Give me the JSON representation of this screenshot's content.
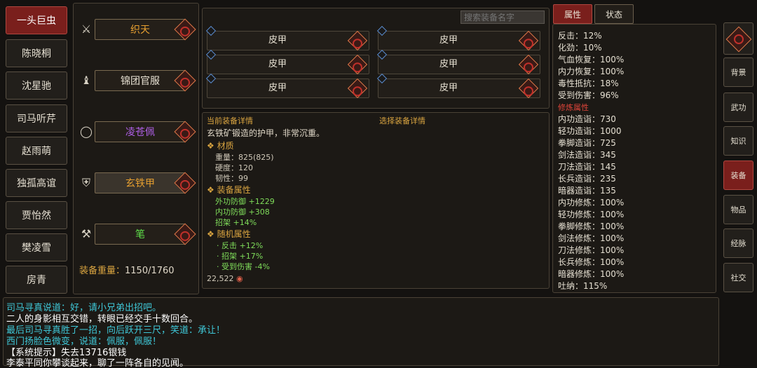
{
  "characters": [
    "一头巨虫",
    "陈晓桐",
    "沈星驰",
    "司马听芹",
    "赵雨萌",
    "独孤高谊",
    "贾怡然",
    "樊凌雪",
    "房青"
  ],
  "equip_slots": [
    {
      "icon": "sword-icon",
      "glyph": "⚔",
      "name": "织天",
      "color": "#e8a030"
    },
    {
      "icon": "robe-icon",
      "glyph": "♝",
      "name": "锦团官服",
      "color": "#e8e2d4"
    },
    {
      "icon": "ring-icon",
      "glyph": "◯",
      "name": "凌苍佩",
      "color": "#b060e8"
    },
    {
      "icon": "armor-icon",
      "glyph": "⛨",
      "name": "玄铁甲",
      "color": "#e8a030"
    },
    {
      "icon": "tool-icon",
      "glyph": "⚒",
      "name": "笔",
      "color": "#5fe04a"
    }
  ],
  "weight_label": "装备重量：",
  "weight_value": "1150/1760",
  "search_placeholder": "搜索装备名字",
  "grid_items": [
    "皮甲",
    "皮甲",
    "皮甲",
    "皮甲",
    "皮甲",
    "皮甲"
  ],
  "detail": {
    "current_header": "当前装备详情",
    "select_header": "选择装备详情",
    "description": "玄铁矿锻造的护甲，非常沉重。",
    "material_title": "❖ 材质",
    "material": [
      "重量：825(825)",
      "硬度：120",
      "韧性：99"
    ],
    "attr_title": "❖ 装备属性",
    "attrs": [
      "外功防御 +1229",
      "内功防御 +308",
      "招架 +14%"
    ],
    "random_title": "❖ 随机属性",
    "random": [
      "· 反击 +12%",
      "· 招架 +17%",
      "· 受到伤害 -4%"
    ],
    "price": "22,522"
  },
  "tabs": [
    "属性",
    "状态"
  ],
  "stats_top": [
    "反击：12%",
    "化劲：10%",
    "气血恢复：100%",
    "内力恢复：100%",
    "毒性抵抗：18%",
    "受到伤害：96%"
  ],
  "stats_header": "修炼属性",
  "stats_train": [
    "内功造诣：730",
    "轻功造诣：1000",
    "拳脚造诣：725",
    "剑法造诣：345",
    "刀法造诣：145",
    "长兵造诣：235",
    "暗器造诣：135",
    "内功修炼：100%",
    "轻功修炼：100%",
    "拳脚修炼：100%",
    "剑法修炼：100%",
    "刀法修炼：100%",
    "长兵修炼：100%",
    "暗器修炼：100%",
    "吐纳：115%"
  ],
  "nav": [
    "背景",
    "武功",
    "知识",
    "装备",
    "物品",
    "经脉",
    "社交"
  ],
  "log": [
    {
      "text": "司马寻真说道：好，请小兄弟出招吧。",
      "color": "#3fc8d8"
    },
    {
      "text": "二人的身影相互交错，转眼已经交手十数回合。",
      "color": "#ffffff"
    },
    {
      "text": "最后司马寻真胜了一招，向后跃开三尺，笑道：承让！",
      "color": "#3fc8d8"
    },
    {
      "text": "西门扬脸色微变，说道：佩服，佩服！",
      "color": "#3fc8d8"
    },
    {
      "text": "【系统提示】失去13716银钱",
      "color": "#ffffff"
    },
    {
      "text": "李泰平同你攀谈起来，聊了一阵各自的见闻。",
      "color": "#ffffff"
    }
  ]
}
